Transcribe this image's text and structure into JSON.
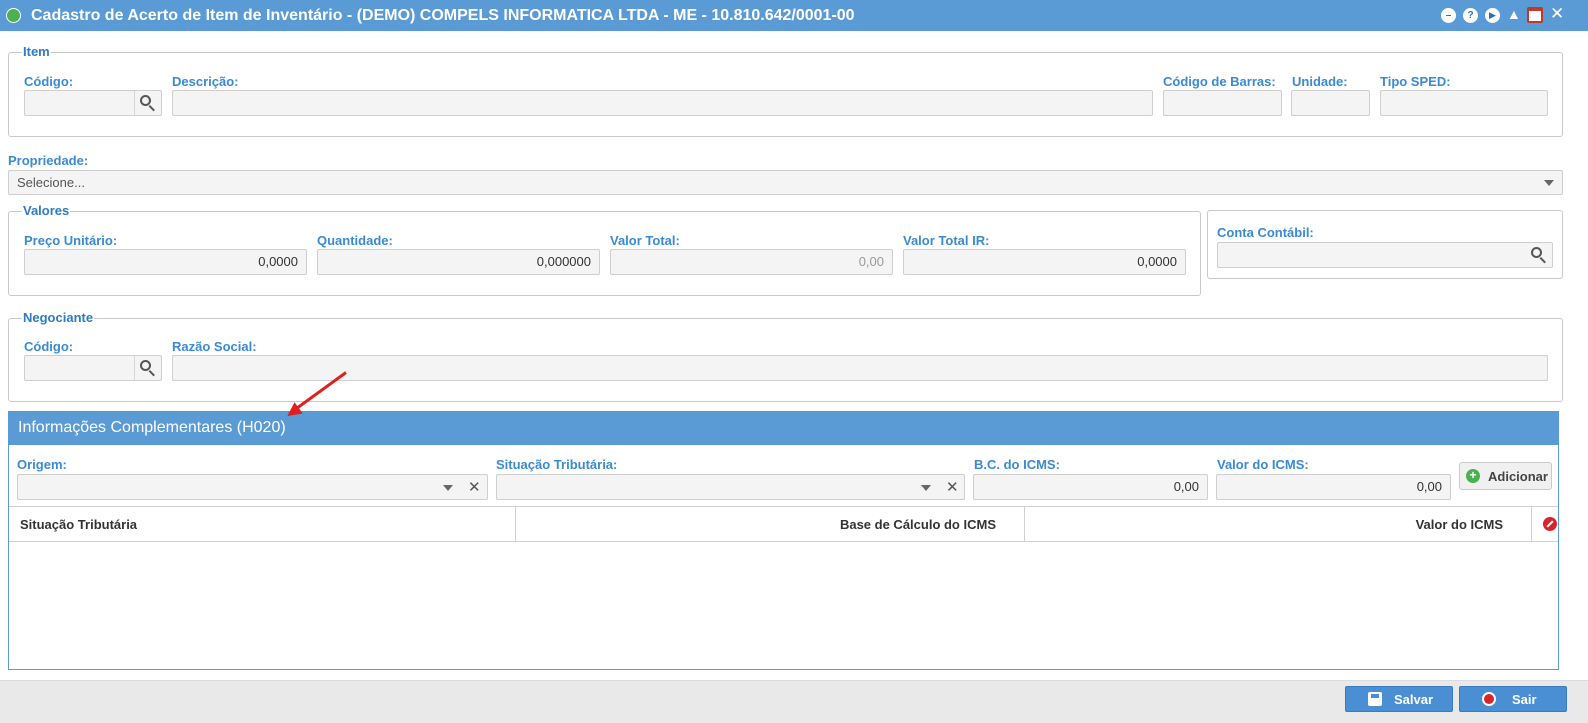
{
  "window": {
    "title": "Cadastro de Acerto de Item de Inventário - (DEMO) COMPELS INFORMATICA LTDA - ME - 10.810.642/0001-00",
    "icons": [
      "app-icon",
      "minimize-icon",
      "help-icon",
      "play-icon",
      "bell-icon",
      "calendar-icon",
      "close-icon"
    ],
    "help_glyph": "?"
  },
  "item": {
    "legend": "Item",
    "codigo_label": "Código:",
    "descricao_label": "Descrição:",
    "codigo_barras_label": "Código de Barras:",
    "unidade_label": "Unidade:",
    "tipo_sped_label": "Tipo SPED:"
  },
  "propriedade": {
    "label": "Propriedade:",
    "placeholder": "Selecione..."
  },
  "valores": {
    "legend": "Valores",
    "preco_unitario_label": "Preço Unitário:",
    "preco_unitario_value": "0,0000",
    "quantidade_label": "Quantidade:",
    "quantidade_value": "0,000000",
    "valor_total_label": "Valor Total:",
    "valor_total_value": "0,00",
    "valor_total_ir_label": "Valor Total IR:",
    "valor_total_ir_value": "0,0000"
  },
  "conta_contabil": {
    "label": "Conta Contábil:"
  },
  "negociante": {
    "legend": "Negociante",
    "codigo_label": "Código:",
    "razao_social_label": "Razão Social:"
  },
  "h020": {
    "title": "Informações Complementares (H020)",
    "origem_label": "Origem:",
    "situacao_label": "Situação Tributária:",
    "bc_icms_label": "B.C. do ICMS:",
    "bc_icms_value": "0,00",
    "valor_icms_label": "Valor do ICMS:",
    "valor_icms_value": "0,00",
    "add_button": "Adicionar",
    "columns": [
      "Situação Tributária",
      "Base de Cálculo do ICMS",
      "Valor do ICMS"
    ],
    "rows": []
  },
  "footer": {
    "save_label": "Salvar",
    "exit_label": "Sair"
  },
  "colors": {
    "accent": "#5b9bd5",
    "label_blue": "#3a8ad4",
    "annotation_arrow": "#e02020",
    "delete_red": "#d9232d",
    "add_green": "#4caf50"
  }
}
